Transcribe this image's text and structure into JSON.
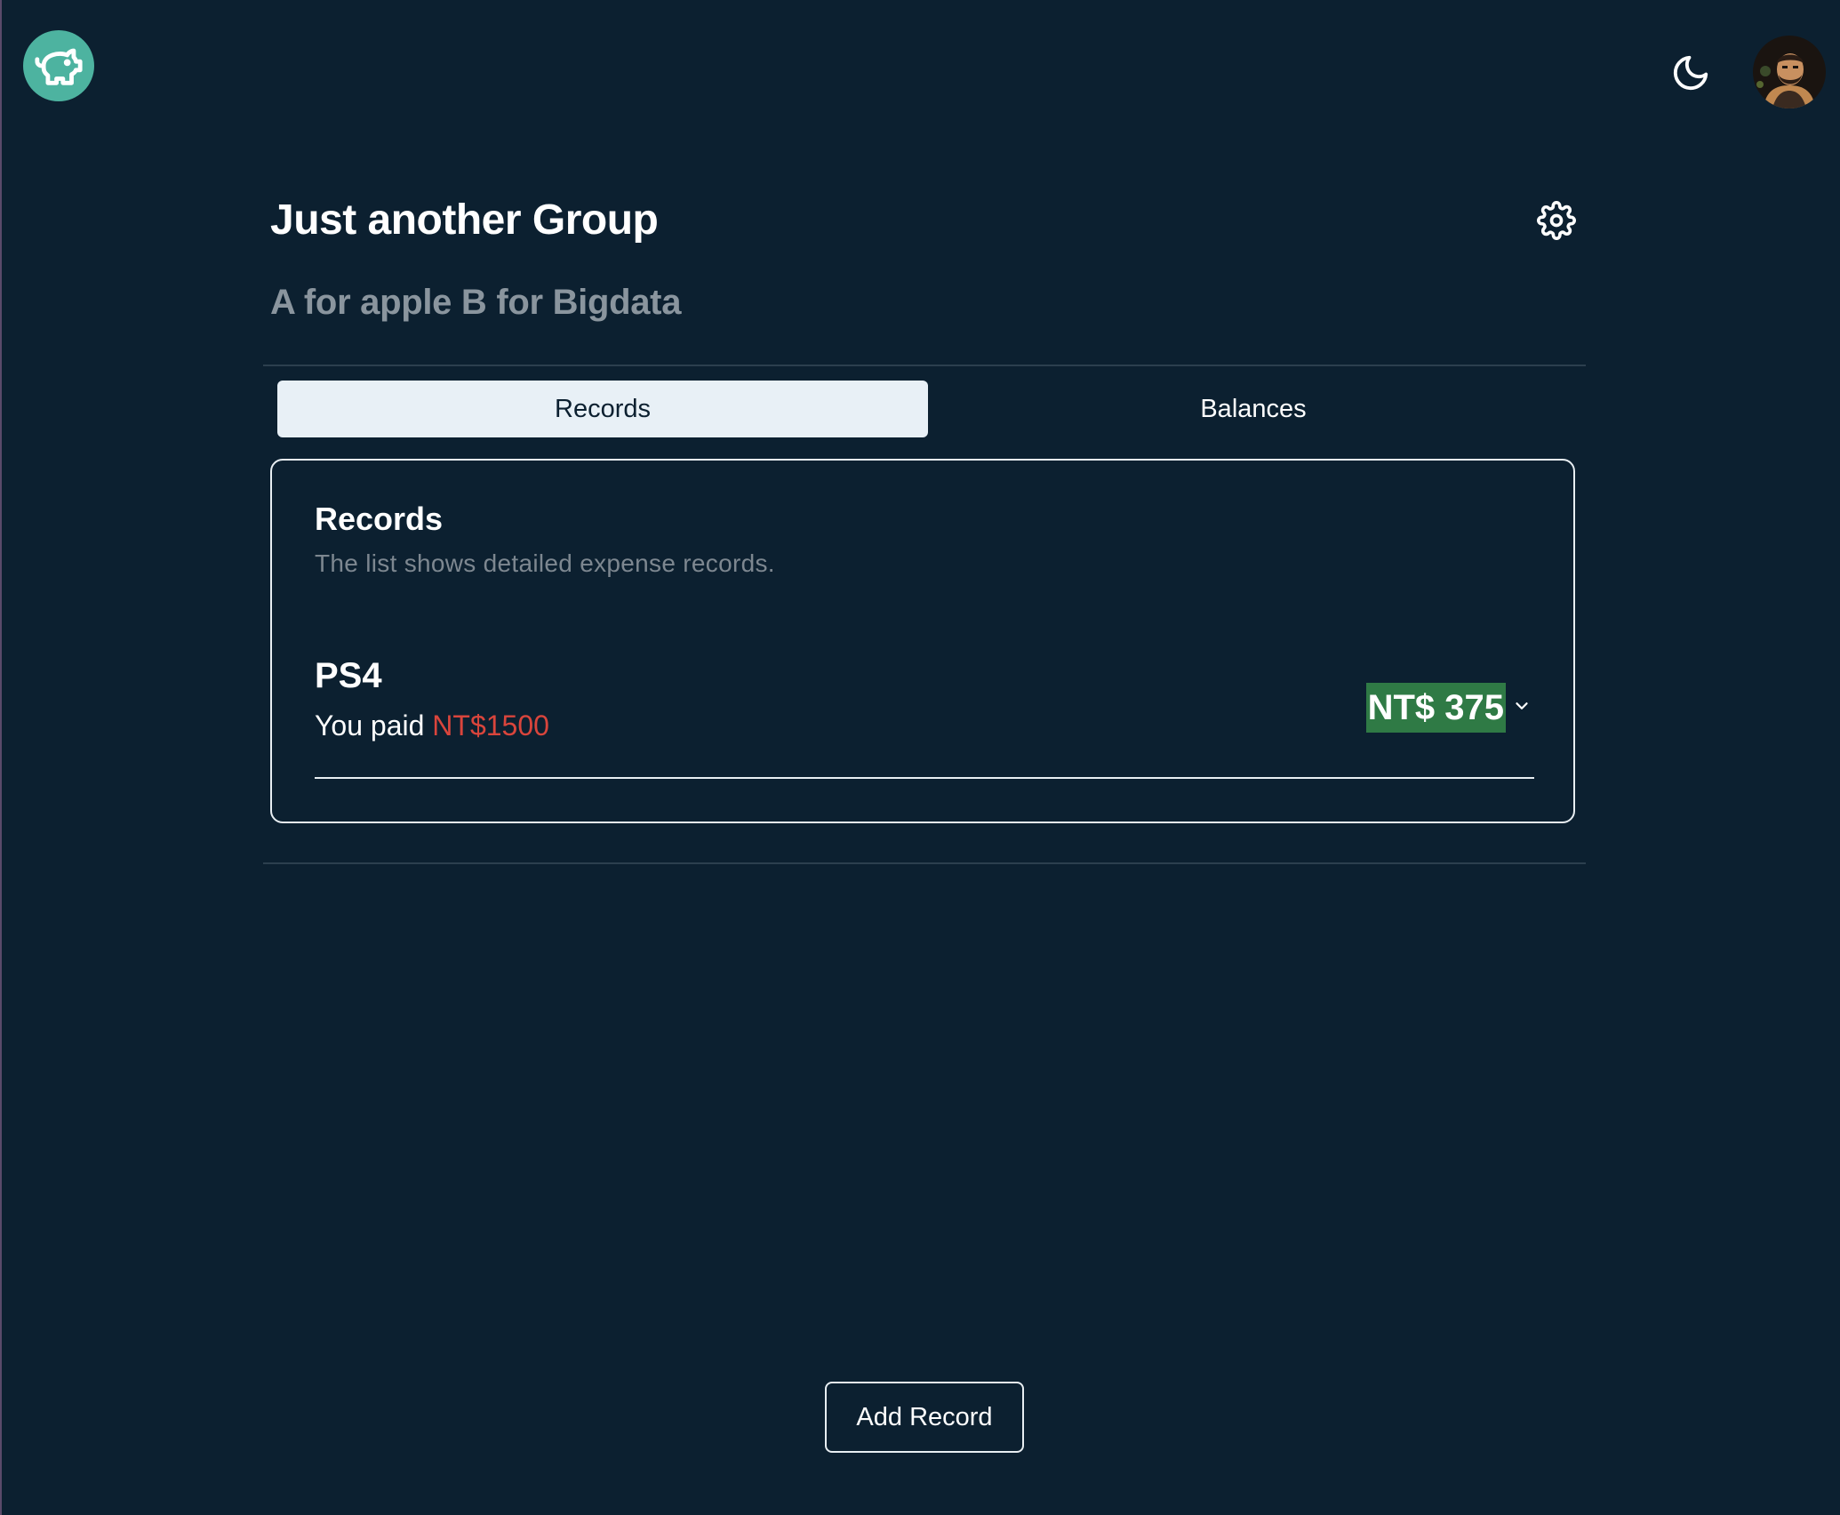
{
  "header": {
    "logo_icon": "piggy-bank-icon",
    "theme_icon": "moon-icon",
    "avatar_icon": "user-avatar"
  },
  "group": {
    "title": "Just another Group",
    "description": "A for apple B for Bigdata",
    "settings_icon": "gear-icon"
  },
  "tabs": [
    {
      "label": "Records",
      "active": true
    },
    {
      "label": "Balances",
      "active": false
    }
  ],
  "records_card": {
    "title": "Records",
    "subtitle": "The list shows detailed expense records.",
    "items": [
      {
        "name": "PS4",
        "paid_prefix": "You paid ",
        "paid_amount": "NT$1500",
        "share": "NT$ 375"
      }
    ]
  },
  "actions": {
    "add_record": "Add Record"
  },
  "colors": {
    "background": "#0c2030",
    "accent": "#4db3a0",
    "paid_red": "#d9453c",
    "share_green": "#2f7a45",
    "muted_text": "#8a959e"
  }
}
